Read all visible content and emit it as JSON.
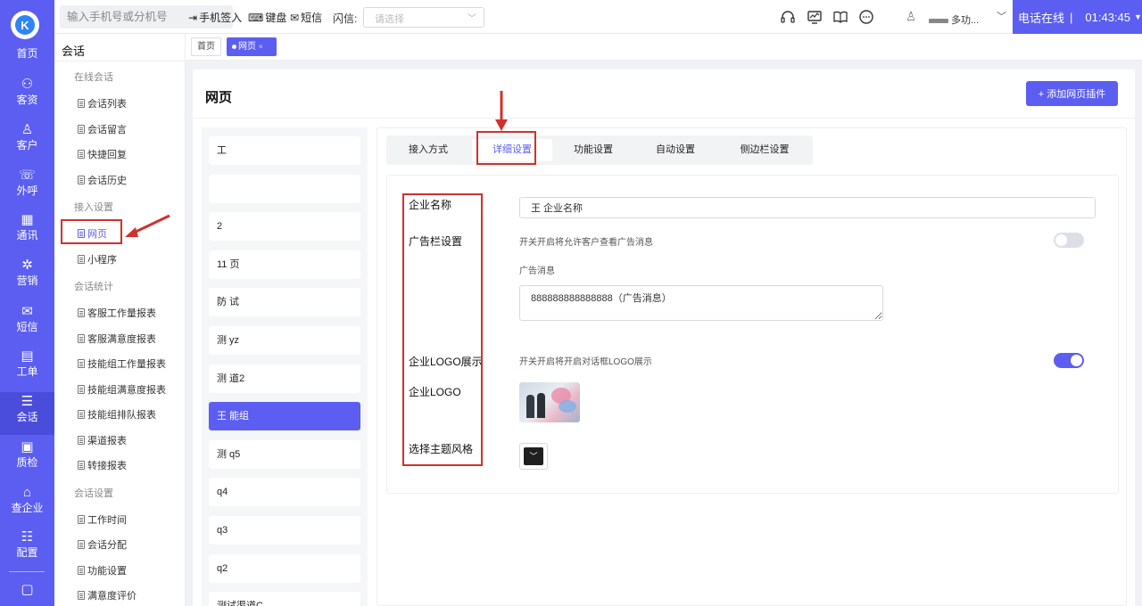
{
  "rail": {
    "items": [
      {
        "icon": "home-icon",
        "glyph": "⌂",
        "label": "首页"
      },
      {
        "icon": "customer-resource-icon",
        "glyph": "⚇",
        "label": "客资"
      },
      {
        "icon": "customer-icon",
        "glyph": "♙",
        "label": "客户"
      },
      {
        "icon": "outbound-call-icon",
        "glyph": "☏",
        "label": "外呼"
      },
      {
        "icon": "communication-icon",
        "glyph": "▦",
        "label": "通讯"
      },
      {
        "icon": "marketing-icon",
        "glyph": "✲",
        "label": "营销"
      },
      {
        "icon": "sms-icon",
        "glyph": "✉",
        "label": "短信"
      },
      {
        "icon": "ticket-icon",
        "glyph": "▤",
        "label": "工单"
      },
      {
        "icon": "chat-icon",
        "glyph": "☰",
        "label": "会话"
      },
      {
        "icon": "quality-check-icon",
        "glyph": "▣",
        "label": "质检"
      },
      {
        "icon": "enterprise-lookup-icon",
        "glyph": "⌂",
        "label": "查企业"
      },
      {
        "icon": "config-icon",
        "glyph": "☷",
        "label": "配置"
      },
      {
        "icon": "more-icon",
        "glyph": "▢",
        "label": ""
      }
    ]
  },
  "topbar": {
    "phone_placeholder": "输入手机号或分机号",
    "phone_signin": "手机签入",
    "keyboard": "键盘",
    "sms": "短信",
    "flash_label": "闪信:",
    "flash_placeholder": "请选择",
    "user_suffix": "多功...",
    "status": "电话在线",
    "separator": "|",
    "timer": "01:43:45"
  },
  "subnav": {
    "title": "会话",
    "groups": [
      {
        "title": "在线会话",
        "items": [
          "会话列表",
          "会话留言",
          "快捷回复",
          "会话历史"
        ]
      },
      {
        "title": "接入设置",
        "items": [
          "网页",
          "小程序"
        ]
      },
      {
        "title": "会话统计",
        "items": [
          "客服工作量报表",
          "客服满意度报表",
          "技能组工作量报表",
          "技能组满意度报表",
          "技能组排队报表",
          "渠道报表",
          "转接报表"
        ]
      },
      {
        "title": "会话设置",
        "items": [
          "工作时间",
          "会话分配",
          "功能设置",
          "满意度评价"
        ]
      }
    ]
  },
  "tabs": {
    "home": "首页",
    "current": "网页",
    "close": "×"
  },
  "page": {
    "title": "网页",
    "add_button": "+ 添加网页插件"
  },
  "plugins": [
    "工",
    "",
    "2",
    "11 页",
    "防 试",
    "测 yz",
    "测 道2",
    "王 能组",
    "测 q5",
    "q4",
    "q3",
    "q2",
    "测试渠道C"
  ],
  "detail": {
    "tabs": [
      "接入方式",
      "详细设置",
      "功能设置",
      "自动设置",
      "侧边栏设置"
    ],
    "active_tab": "详细设置",
    "labels": {
      "company_name": "企业名称",
      "ad_settings": "广告栏设置",
      "logo_display": "企业LOGO展示",
      "logo": "企业LOGO",
      "theme": "选择主题风格"
    },
    "company_name_value": "王 企业名称",
    "ad_hint": "开关开启将允许客户查看广告消息",
    "ad_toggle_on": false,
    "ad_message_label": "广告消息",
    "ad_message_value": "888888888888888（广告消息）",
    "logo_hint": "开关开启将开启对话框LOGO展示",
    "logo_toggle_on": true,
    "theme_color": "#1f1f1f"
  },
  "colors": {
    "brand": "#5b5ef0",
    "annotation": "#d0312d"
  }
}
